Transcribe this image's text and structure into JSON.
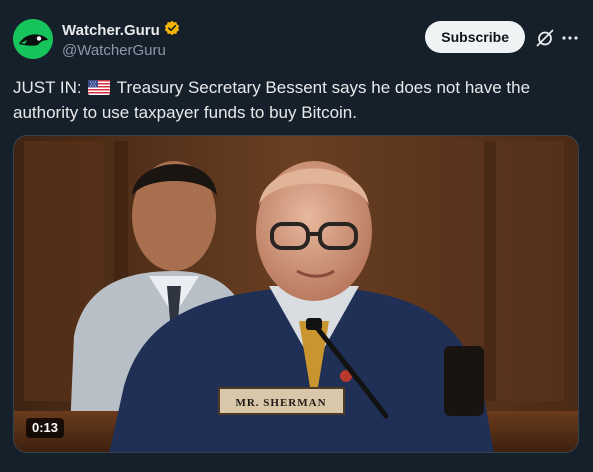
{
  "account": {
    "display_name": "Watcher.Guru",
    "handle": "@WatcherGuru",
    "verified": true,
    "verified_color": "#f4b400",
    "avatar_color": "#17c35b"
  },
  "actions": {
    "subscribe_label": "Subscribe",
    "grok_icon": "grok-icon",
    "more_icon": "more-icon"
  },
  "post": {
    "text_prefix": "JUST IN:",
    "flag": "us-flag",
    "text_body": "Treasury Secretary Bessent says he does not have the authority to use taxpayer funds to buy Bitcoin."
  },
  "video": {
    "timestamp": "0:13",
    "nameplate": "MR. SHERMAN"
  },
  "colors": {
    "background": "#15202b",
    "text": "#e7e9ea",
    "secondary_text": "#8b98a5"
  }
}
